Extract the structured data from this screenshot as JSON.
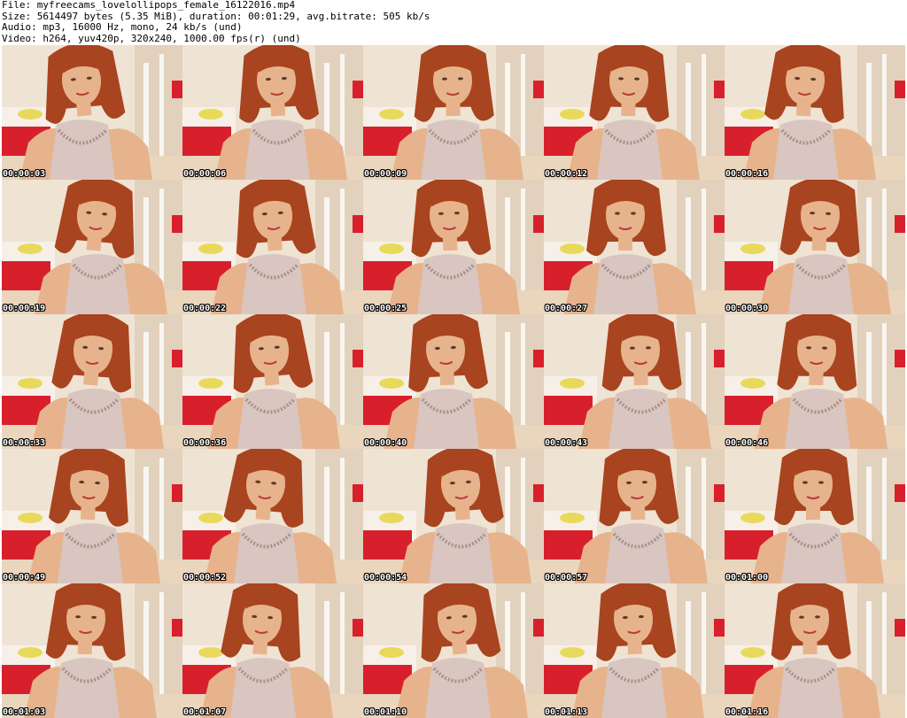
{
  "header": {
    "file_line": "File: myfreecams_lovelollipops_female_16122016.mp4",
    "size_line": "Size: 5614497 bytes (5.35 MiB), duration: 00:01:29, avg.bitrate: 505 kb/s",
    "audio_line": "Audio: mp3, 16000 Hz, mono, 24 kb/s (und)",
    "video_line": "Video: h264, yuv420p, 320x240, 1000.00 fps(r) (und)"
  },
  "colors": {
    "wall": "#efe3d3",
    "wall_shadow": "#d9c5ad",
    "bed_red": "#d8202c",
    "floor": "#e9d6bd",
    "hair": "#a8441f",
    "skin": "#e7b38d",
    "top": "#d9c6c0",
    "lace": "#a9908a",
    "pillow_yellow": "#e8d64a"
  },
  "frames": [
    {
      "timestamp": "00:00:03"
    },
    {
      "timestamp": "00:00:06"
    },
    {
      "timestamp": "00:00:09"
    },
    {
      "timestamp": "00:00:12"
    },
    {
      "timestamp": "00:00:16"
    },
    {
      "timestamp": "00:00:19"
    },
    {
      "timestamp": "00:00:22"
    },
    {
      "timestamp": "00:00:25"
    },
    {
      "timestamp": "00:00:27"
    },
    {
      "timestamp": "00:00:30"
    },
    {
      "timestamp": "00:00:33"
    },
    {
      "timestamp": "00:00:36"
    },
    {
      "timestamp": "00:00:40"
    },
    {
      "timestamp": "00:00:43"
    },
    {
      "timestamp": "00:00:46"
    },
    {
      "timestamp": "00:00:49"
    },
    {
      "timestamp": "00:00:52"
    },
    {
      "timestamp": "00:00:54"
    },
    {
      "timestamp": "00:00:57"
    },
    {
      "timestamp": "00:01:00"
    },
    {
      "timestamp": "00:01:03"
    },
    {
      "timestamp": "00:01:07"
    },
    {
      "timestamp": "00:01:10"
    },
    {
      "timestamp": "00:01:13"
    },
    {
      "timestamp": "00:01:16"
    }
  ]
}
